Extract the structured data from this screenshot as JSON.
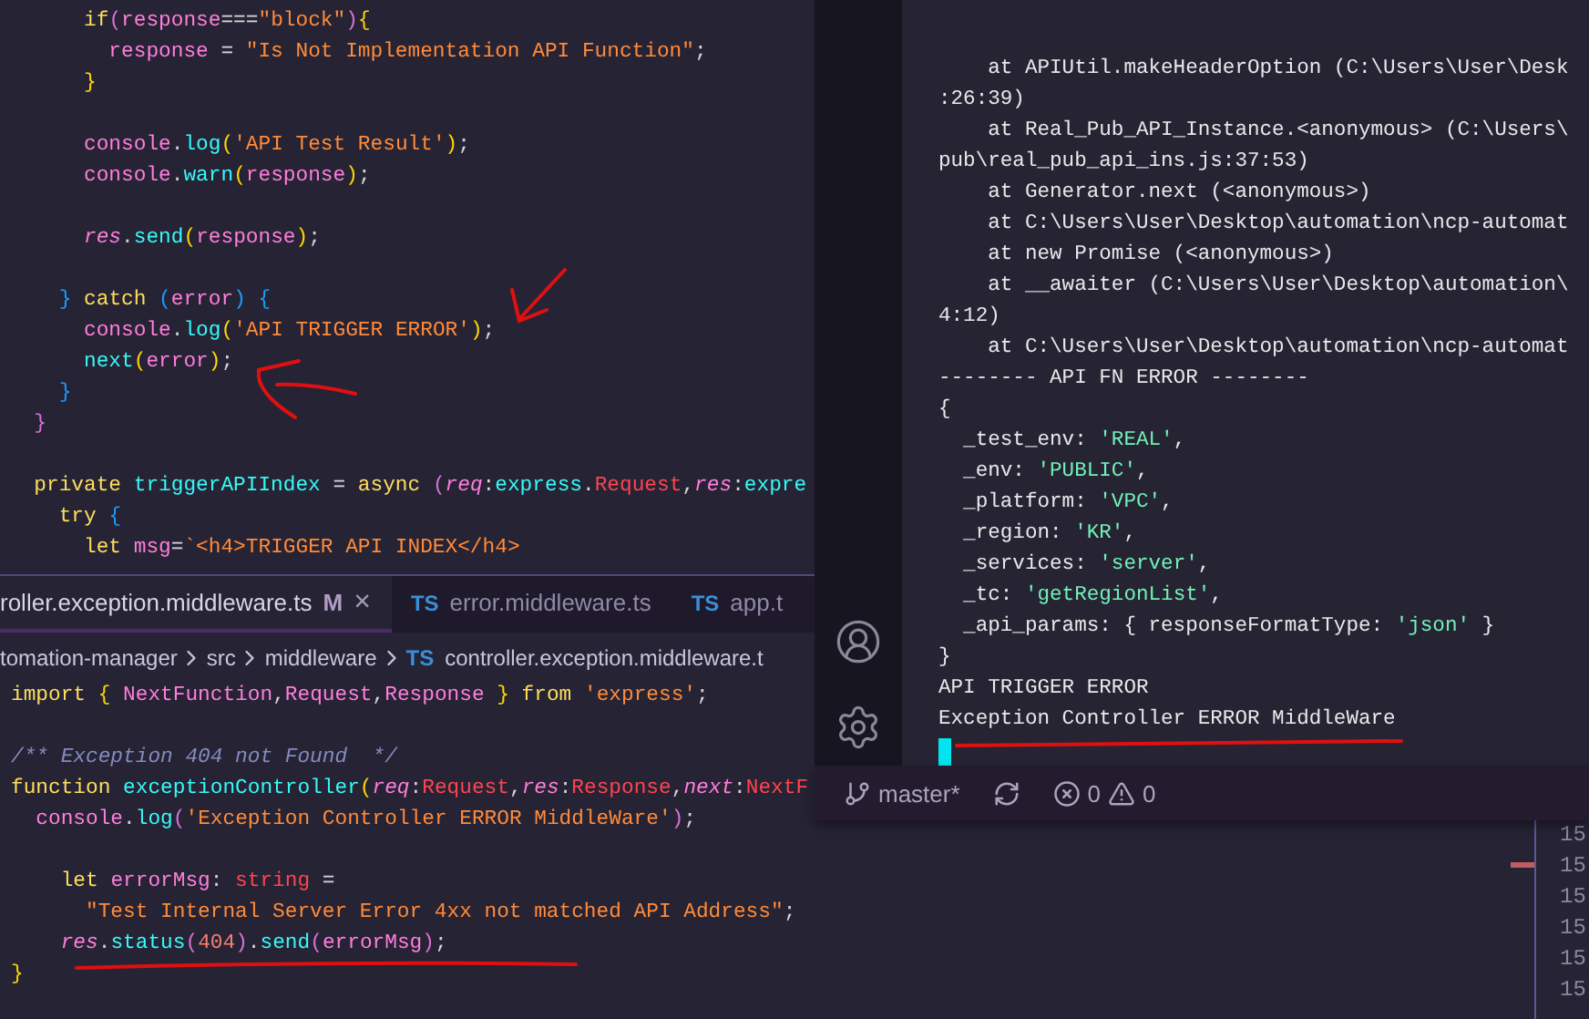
{
  "top_editor": {
    "lines": [
      {
        "tokens": [
          {
            "kind": "kw",
            "text": "      if"
          },
          {
            "kind": "brk_p",
            "text": "("
          },
          {
            "kind": "var",
            "text": "response"
          },
          {
            "kind": "punc",
            "text": "==="
          },
          {
            "kind": "str",
            "text": "\"block\""
          },
          {
            "kind": "brk_p",
            "text": ")"
          },
          {
            "kind": "brk_y",
            "text": "{"
          }
        ]
      },
      {
        "tokens": [
          {
            "kind": "var",
            "text": "        response"
          },
          {
            "kind": "punc",
            "text": " = "
          },
          {
            "kind": "str",
            "text": "\"Is Not Implementation API Function\""
          },
          {
            "kind": "punc",
            "text": ";"
          }
        ]
      },
      {
        "tokens": [
          {
            "kind": "brk_y",
            "text": "      }"
          }
        ]
      },
      {
        "gap_before": true,
        "tokens": [
          {
            "kind": "var",
            "text": "      console"
          },
          {
            "kind": "punc",
            "text": "."
          },
          {
            "kind": "fn",
            "text": "log"
          },
          {
            "kind": "brk_y",
            "text": "("
          },
          {
            "kind": "str",
            "text": "'API Test Result'"
          },
          {
            "kind": "brk_y",
            "text": ")"
          },
          {
            "kind": "punc",
            "text": ";"
          }
        ]
      },
      {
        "tokens": [
          {
            "kind": "var",
            "text": "      console"
          },
          {
            "kind": "punc",
            "text": "."
          },
          {
            "kind": "fn",
            "text": "warn"
          },
          {
            "kind": "brk_y",
            "text": "("
          },
          {
            "kind": "var",
            "text": "response"
          },
          {
            "kind": "brk_y",
            "text": ")"
          },
          {
            "kind": "punc",
            "text": ";"
          }
        ]
      },
      {
        "gap_before": true,
        "tokens": [
          {
            "kind": "param",
            "text": "      res"
          },
          {
            "kind": "punc",
            "text": "."
          },
          {
            "kind": "fn",
            "text": "send"
          },
          {
            "kind": "brk_y",
            "text": "("
          },
          {
            "kind": "var",
            "text": "response"
          },
          {
            "kind": "brk_y",
            "text": ")"
          },
          {
            "kind": "punc",
            "text": ";"
          }
        ]
      },
      {
        "gap_before": true,
        "tokens": [
          {
            "kind": "brk_b",
            "text": "    }"
          },
          {
            "kind": "kw",
            "text": " catch "
          },
          {
            "kind": "brk_b",
            "text": "("
          },
          {
            "kind": "var",
            "text": "error"
          },
          {
            "kind": "brk_b",
            "text": ")"
          },
          {
            "kind": "brk_b",
            "text": " {"
          }
        ]
      },
      {
        "tokens": [
          {
            "kind": "var",
            "text": "      console"
          },
          {
            "kind": "punc",
            "text": "."
          },
          {
            "kind": "fn",
            "text": "log"
          },
          {
            "kind": "brk_y",
            "text": "("
          },
          {
            "kind": "str",
            "text": "'API TRIGGER ERROR'"
          },
          {
            "kind": "brk_y",
            "text": ")"
          },
          {
            "kind": "punc",
            "text": ";"
          }
        ]
      },
      {
        "tokens": [
          {
            "kind": "fn",
            "text": "      next"
          },
          {
            "kind": "brk_y",
            "text": "("
          },
          {
            "kind": "var",
            "text": "error"
          },
          {
            "kind": "brk_y",
            "text": ")"
          },
          {
            "kind": "punc",
            "text": ";"
          }
        ]
      },
      {
        "tokens": [
          {
            "kind": "brk_b",
            "text": "    }"
          }
        ]
      },
      {
        "tokens": [
          {
            "kind": "brk_p",
            "text": "  }"
          }
        ]
      },
      {
        "gap_before": true,
        "tokens": [
          {
            "kind": "kw",
            "text": "  private "
          },
          {
            "kind": "fn",
            "text": "triggerAPIIndex"
          },
          {
            "kind": "punc",
            "text": " = "
          },
          {
            "kind": "kw",
            "text": "async "
          },
          {
            "kind": "brk_p",
            "text": "("
          },
          {
            "kind": "param",
            "text": "req"
          },
          {
            "kind": "punc",
            "text": ":"
          },
          {
            "kind": "fn",
            "text": "express"
          },
          {
            "kind": "punc",
            "text": "."
          },
          {
            "kind": "type",
            "text": "Request"
          },
          {
            "kind": "punc",
            "text": ","
          },
          {
            "kind": "param",
            "text": "res"
          },
          {
            "kind": "punc",
            "text": ":"
          },
          {
            "kind": "fn",
            "text": "expre"
          }
        ]
      },
      {
        "tokens": [
          {
            "kind": "kw",
            "text": "    try "
          },
          {
            "kind": "brk_b",
            "text": "{"
          }
        ]
      },
      {
        "tokens": [
          {
            "kind": "kw",
            "text": "      let "
          },
          {
            "kind": "var",
            "text": "msg"
          },
          {
            "kind": "punc",
            "text": "="
          },
          {
            "kind": "str",
            "text": "`<h4>TRIGGER API INDEX</h4>"
          }
        ]
      }
    ]
  },
  "bottom_editor": {
    "tabs": [
      {
        "label": "roller.exception.middleware.ts",
        "badge": "M",
        "close": "×",
        "selected": true
      },
      {
        "file_type": "TS",
        "label": "error.middleware.ts",
        "selected": false
      },
      {
        "file_type": "TS",
        "label": "app.t",
        "selected": false
      }
    ],
    "breadcrumb": [
      {
        "label": "tomation-manager"
      },
      {
        "label": "src"
      },
      {
        "label": "middleware"
      },
      {
        "file_type": "TS",
        "label": "controller.exception.middleware.t"
      }
    ],
    "lines": [
      {
        "tokens": [
          {
            "kind": "kw",
            "text": "import "
          },
          {
            "kind": "brk_y",
            "text": "{ "
          },
          {
            "kind": "var",
            "text": "NextFunction"
          },
          {
            "kind": "punc",
            "text": ","
          },
          {
            "kind": "var",
            "text": "Request"
          },
          {
            "kind": "punc",
            "text": ","
          },
          {
            "kind": "var",
            "text": "Response"
          },
          {
            "kind": "brk_y",
            "text": " }"
          },
          {
            "kind": "kw",
            "text": " from "
          },
          {
            "kind": "str",
            "text": "'express'"
          },
          {
            "kind": "punc",
            "text": ";"
          }
        ]
      },
      {
        "gap_before": true,
        "tokens": [
          {
            "kind": "cmt",
            "text": "/** Exception 404 not Found  */"
          }
        ]
      },
      {
        "tokens": [
          {
            "kind": "kw",
            "text": "function "
          },
          {
            "kind": "fn",
            "text": "exceptionController"
          },
          {
            "kind": "brk_y",
            "text": "("
          },
          {
            "kind": "param",
            "text": "req"
          },
          {
            "kind": "punc",
            "text": ":"
          },
          {
            "kind": "type",
            "text": "Request"
          },
          {
            "kind": "punc",
            "text": ","
          },
          {
            "kind": "param",
            "text": "res"
          },
          {
            "kind": "punc",
            "text": ":"
          },
          {
            "kind": "type",
            "text": "Response"
          },
          {
            "kind": "punc",
            "text": ","
          },
          {
            "kind": "param",
            "text": "next"
          },
          {
            "kind": "punc",
            "text": ":"
          },
          {
            "kind": "type",
            "text": "NextF"
          }
        ]
      },
      {
        "tokens": [
          {
            "kind": "var",
            "text": "  console"
          },
          {
            "kind": "punc",
            "text": "."
          },
          {
            "kind": "fn",
            "text": "log"
          },
          {
            "kind": "brk_p",
            "text": "("
          },
          {
            "kind": "str",
            "text": "'Exception Controller ERROR MiddleWare'"
          },
          {
            "kind": "brk_p",
            "text": ")"
          },
          {
            "kind": "punc",
            "text": ";"
          }
        ]
      },
      {
        "gap_before": true,
        "tokens": [
          {
            "kind": "kw",
            "text": "    let "
          },
          {
            "kind": "var",
            "text": "errorMsg"
          },
          {
            "kind": "punc",
            "text": ": "
          },
          {
            "kind": "type",
            "text": "string"
          },
          {
            "kind": "punc",
            "text": " ="
          }
        ]
      },
      {
        "tokens": [
          {
            "kind": "str",
            "text": "      \"Test Internal Server Error 4xx not matched API Address\""
          },
          {
            "kind": "punc",
            "text": ";"
          }
        ]
      },
      {
        "tokens": [
          {
            "kind": "param",
            "text": "    res"
          },
          {
            "kind": "punc",
            "text": "."
          },
          {
            "kind": "fn",
            "text": "status"
          },
          {
            "kind": "brk_p",
            "text": "("
          },
          {
            "kind": "num",
            "text": "404"
          },
          {
            "kind": "brk_p",
            "text": ")"
          },
          {
            "kind": "punc",
            "text": "."
          },
          {
            "kind": "fn",
            "text": "send"
          },
          {
            "kind": "brk_p",
            "text": "("
          },
          {
            "kind": "var",
            "text": "errorMsg"
          },
          {
            "kind": "brk_p",
            "text": ")"
          },
          {
            "kind": "punc",
            "text": ";"
          }
        ]
      },
      {
        "tokens": [
          {
            "kind": "brk_y",
            "text": "}"
          }
        ]
      }
    ]
  },
  "terminal": {
    "lines": [
      [
        {
          "kind": "plain",
          "text": "    at APIUtil.makeHeaderOption (C:\\Users\\User\\Desk"
        }
      ],
      [
        {
          "kind": "plain",
          "text": ":26:39)"
        }
      ],
      [
        {
          "kind": "plain",
          "text": "    at Real_Pub_API_Instance.<anonymous> (C:\\Users\\"
        }
      ],
      [
        {
          "kind": "plain",
          "text": "pub\\real_pub_api_ins.js:37:53)"
        }
      ],
      [
        {
          "kind": "plain",
          "text": "    at Generator.next (<anonymous>)"
        }
      ],
      [
        {
          "kind": "plain",
          "text": "    at C:\\Users\\User\\Desktop\\automation\\ncp-automat"
        }
      ],
      [
        {
          "kind": "plain",
          "text": "    at new Promise (<anonymous>)"
        }
      ],
      [
        {
          "kind": "plain",
          "text": "    at __awaiter (C:\\Users\\User\\Desktop\\automation\\"
        }
      ],
      [
        {
          "kind": "plain",
          "text": "4:12)"
        }
      ],
      [
        {
          "kind": "plain",
          "text": "    at C:\\Users\\User\\Desktop\\automation\\ncp-automat"
        }
      ],
      [
        {
          "kind": "plain",
          "text": "-------- API FN ERROR --------"
        }
      ],
      [
        {
          "kind": "plain",
          "text": "{"
        }
      ],
      [
        {
          "kind": "plain",
          "text": "  _test_env: "
        },
        {
          "kind": "str",
          "text": "'REAL'"
        },
        {
          "kind": "plain",
          "text": ","
        }
      ],
      [
        {
          "kind": "plain",
          "text": "  _env: "
        },
        {
          "kind": "str",
          "text": "'PUBLIC'"
        },
        {
          "kind": "plain",
          "text": ","
        }
      ],
      [
        {
          "kind": "plain",
          "text": "  _platform: "
        },
        {
          "kind": "str",
          "text": "'VPC'"
        },
        {
          "kind": "plain",
          "text": ","
        }
      ],
      [
        {
          "kind": "plain",
          "text": "  _region: "
        },
        {
          "kind": "str",
          "text": "'KR'"
        },
        {
          "kind": "plain",
          "text": ","
        }
      ],
      [
        {
          "kind": "plain",
          "text": "  _services: "
        },
        {
          "kind": "str",
          "text": "'server'"
        },
        {
          "kind": "plain",
          "text": ","
        }
      ],
      [
        {
          "kind": "plain",
          "text": "  _tc: "
        },
        {
          "kind": "str",
          "text": "'getRegionList'"
        },
        {
          "kind": "plain",
          "text": ","
        }
      ],
      [
        {
          "kind": "plain",
          "text": "  _api_params: { responseFormatType: "
        },
        {
          "kind": "str",
          "text": "'json'"
        },
        {
          "kind": "plain",
          "text": " }"
        }
      ],
      [
        {
          "kind": "plain",
          "text": "}"
        }
      ],
      [
        {
          "kind": "plain",
          "text": "API TRIGGER ERROR"
        }
      ],
      [
        {
          "kind": "plain",
          "text": "Exception Controller ERROR MiddleWare"
        }
      ]
    ]
  },
  "status_bar": {
    "branch": "master*",
    "errors": "0",
    "warnings": "0"
  },
  "right_editor": {
    "line_numbers": [
      "15",
      "15",
      "15",
      "15",
      "15",
      "15"
    ]
  }
}
